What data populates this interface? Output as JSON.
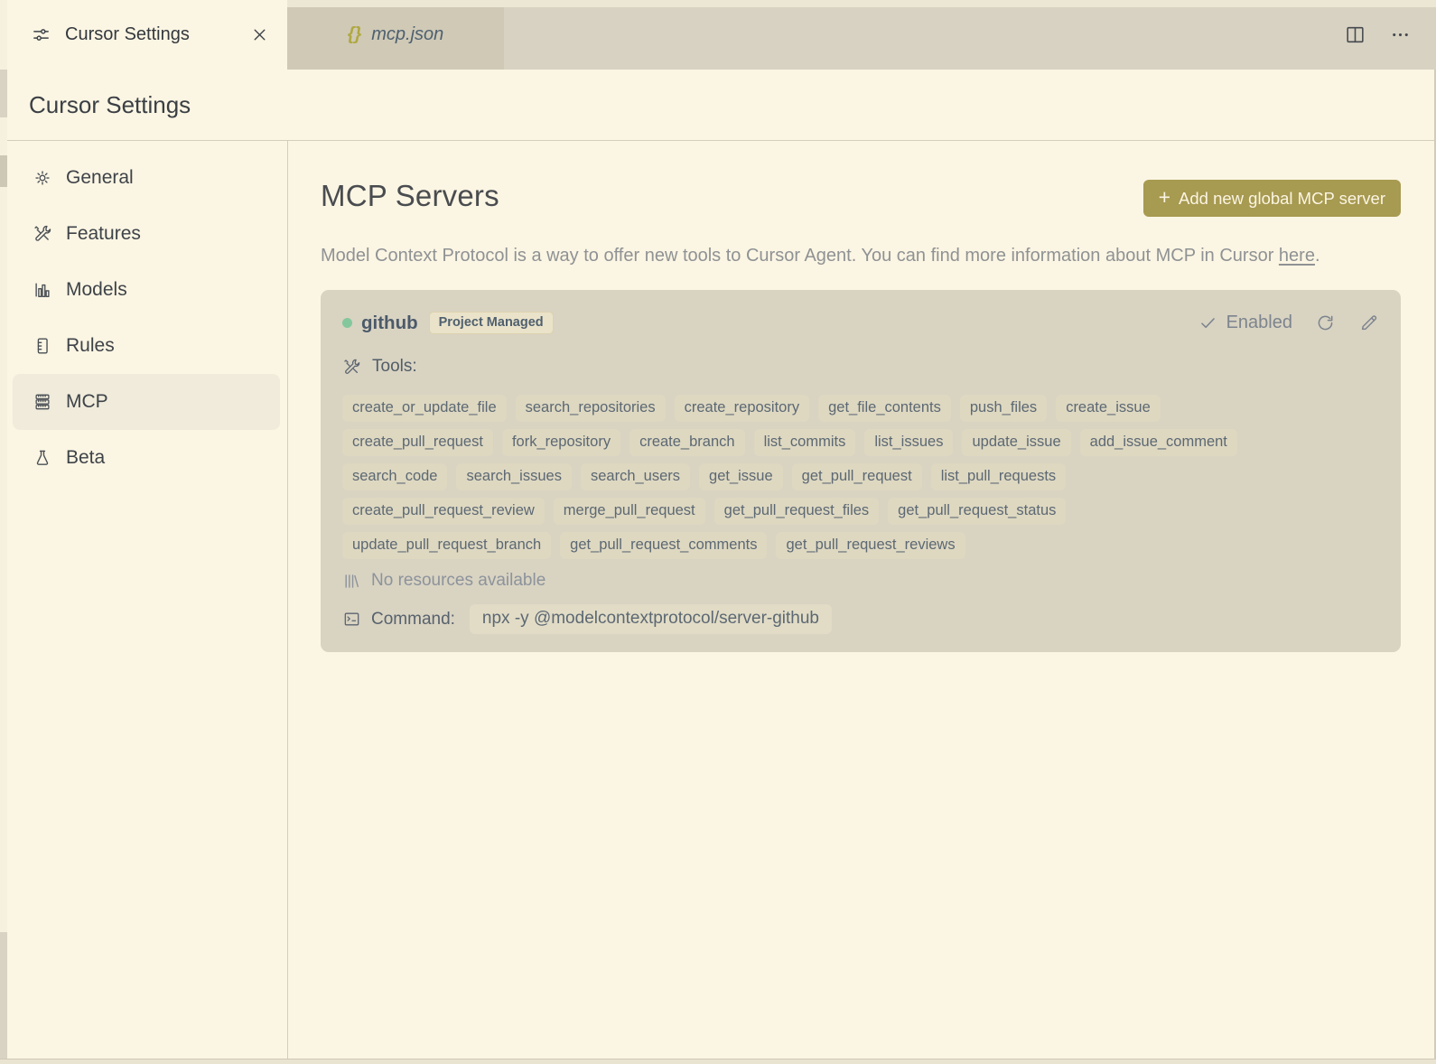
{
  "tab_bar": {
    "active_tab": {
      "label": "Cursor Settings"
    },
    "preview_tab": {
      "label": "mcp.json",
      "braces_glyph": "{}"
    }
  },
  "settings_header": {
    "title": "Cursor Settings"
  },
  "sidebar": {
    "items": [
      {
        "id": "general",
        "label": "General",
        "icon": "gear-icon",
        "selected": false
      },
      {
        "id": "features",
        "label": "Features",
        "icon": "tools-icon",
        "selected": false
      },
      {
        "id": "models",
        "label": "Models",
        "icon": "bar-chart-icon",
        "selected": false
      },
      {
        "id": "rules",
        "label": "Rules",
        "icon": "ruled-page-icon",
        "selected": false
      },
      {
        "id": "mcp",
        "label": "MCP",
        "icon": "server-stack-icon",
        "selected": true
      },
      {
        "id": "beta",
        "label": "Beta",
        "icon": "beaker-icon",
        "selected": false
      }
    ]
  },
  "main": {
    "title": "MCP Servers",
    "add_server_button": {
      "plus": "+",
      "label": "Add new global MCP server"
    },
    "description": {
      "before_link": "Model Context Protocol is a way to offer new tools to Cursor Agent. You can find more information about MCP in Cursor ",
      "link": "here",
      "after_link": "."
    },
    "server_card": {
      "name": "github",
      "badge": "Project Managed",
      "status_label": "Enabled",
      "tools_label": "Tools:",
      "tool_rows": [
        [
          "create_or_update_file",
          "search_repositories",
          "create_repository",
          "get_file_contents",
          "push_files",
          "create_issue"
        ],
        [
          "create_pull_request",
          "fork_repository",
          "create_branch",
          "list_commits",
          "list_issues",
          "update_issue",
          "add_issue_comment"
        ],
        [
          "search_code",
          "search_issues",
          "search_users",
          "get_issue",
          "get_pull_request",
          "list_pull_requests"
        ],
        [
          "create_pull_request_review",
          "merge_pull_request",
          "get_pull_request_files",
          "get_pull_request_status"
        ],
        [
          "update_pull_request_branch",
          "get_pull_request_comments",
          "get_pull_request_reviews"
        ]
      ],
      "resources_text": "No resources available",
      "command_label": "Command:",
      "command_value": "npx -y @modelcontextprotocol/server-github"
    }
  },
  "colors": {
    "accent_olive": "#a79a51",
    "status_green": "#84c79d",
    "background_cream": "#fbf5e3",
    "tab_strip": "#d8d2c2",
    "card_background": "#d9d3c2"
  }
}
